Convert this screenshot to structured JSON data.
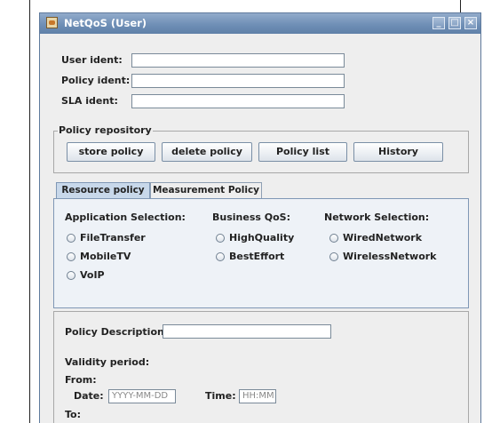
{
  "window": {
    "title": "NetQoS (User)",
    "controls": {
      "minimize": "_",
      "maximize": "□",
      "close": "×"
    }
  },
  "idents": [
    {
      "label": "User ident:",
      "value": ""
    },
    {
      "label": "Policy ident:",
      "value": ""
    },
    {
      "label": "SLA ident:",
      "value": ""
    }
  ],
  "repository": {
    "title": "Policy repository",
    "buttons": [
      "store policy",
      "delete policy",
      "Policy list",
      "History"
    ]
  },
  "tabs": [
    {
      "label": "Resource policy",
      "selected": true
    },
    {
      "label": "Measurement Policy",
      "selected": false
    }
  ],
  "resource": {
    "columns": [
      {
        "header": "Application Selection:",
        "options": [
          "FileTransfer",
          "MobileTV",
          "VoIP"
        ]
      },
      {
        "header": "Business QoS:",
        "options": [
          "HighQuality",
          "BestEffort"
        ]
      },
      {
        "header": "Network Selection:",
        "options": [
          "WiredNetwork",
          "WirelessNetwork"
        ]
      }
    ]
  },
  "description": {
    "label": "Policy Description",
    "value": "",
    "validity_label": "Validity period:",
    "from_label": "From:",
    "date_label": "Date:",
    "date_placeholder": "YYYY-MM-DD",
    "time_label": "Time:",
    "time_placeholder": "HH:MM",
    "to_label": "To:"
  }
}
